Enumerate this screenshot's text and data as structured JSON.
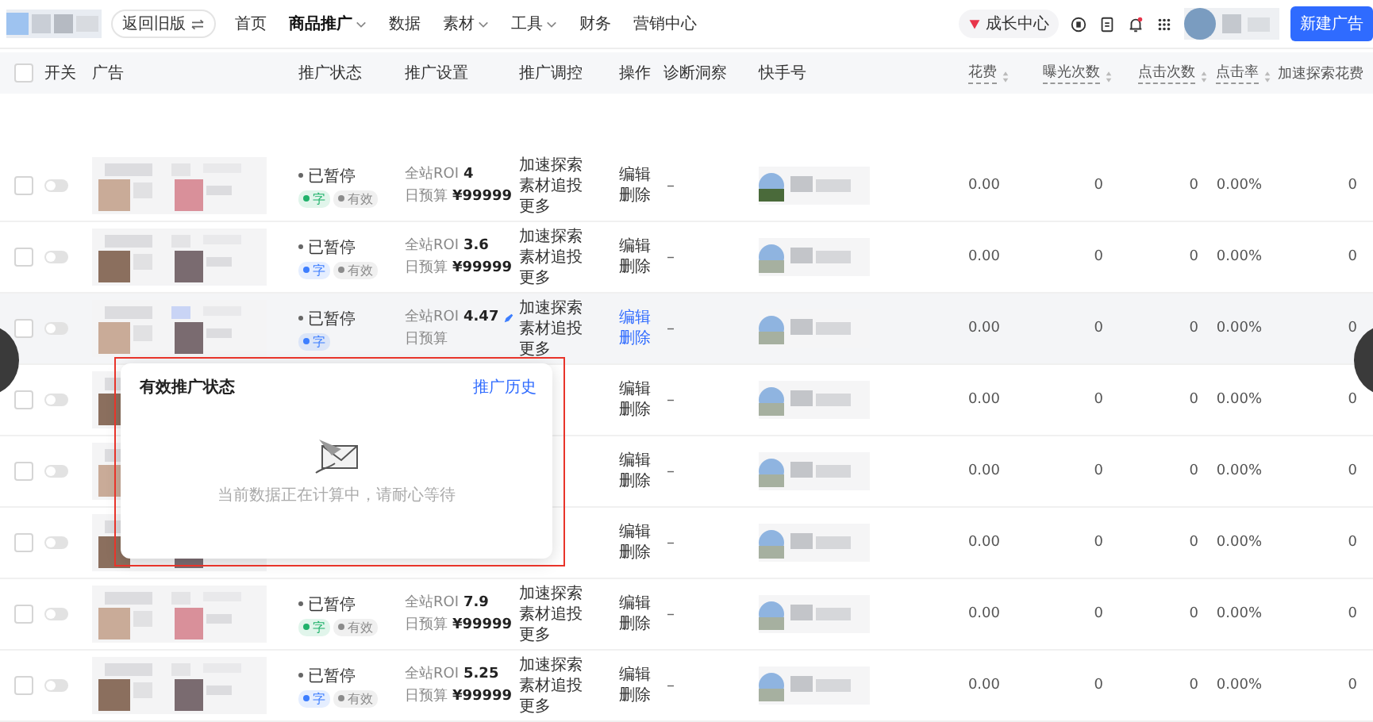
{
  "nav": {
    "back_label": "返回旧版",
    "menu": [
      {
        "label": "首页",
        "selected": false,
        "dropdown": false
      },
      {
        "label": "商品推广",
        "selected": true,
        "dropdown": true
      },
      {
        "label": "数据",
        "selected": false,
        "dropdown": false
      },
      {
        "label": "素材",
        "selected": false,
        "dropdown": true
      },
      {
        "label": "工具",
        "selected": false,
        "dropdown": true
      },
      {
        "label": "财务",
        "selected": false,
        "dropdown": false
      },
      {
        "label": "营销中心",
        "selected": false,
        "dropdown": false
      }
    ],
    "growth_label": "成长中心",
    "create_button": "新建广告"
  },
  "table": {
    "select_all_checked": false,
    "columns": [
      {
        "label": "开关",
        "sortable": false
      },
      {
        "label": "广告",
        "sortable": false
      },
      {
        "label": "推广状态",
        "sortable": false
      },
      {
        "label": "推广设置",
        "sortable": false
      },
      {
        "label": "推广调控",
        "sortable": false
      },
      {
        "label": "操作",
        "sortable": false
      },
      {
        "label": "诊断洞察",
        "sortable": false
      },
      {
        "label": "快手号",
        "sortable": false
      },
      {
        "label": "花费",
        "sortable": true
      },
      {
        "label": "曝光次数",
        "sortable": true
      },
      {
        "label": "点击次数",
        "sortable": true
      },
      {
        "label": "点击率",
        "sortable": true
      },
      {
        "label": "加速探索花费",
        "sortable": false
      }
    ],
    "rows": [
      {
        "hovered": false,
        "checked": false,
        "switch_on": false,
        "status": "已暂停",
        "tags": [
          {
            "label": "字",
            "color": "#21b26b"
          },
          {
            "label": "有效",
            "color": "#8c8c8c"
          }
        ],
        "roi_label": "全站ROI",
        "roi": "4",
        "budget_label": "日预算",
        "budget": "¥99999",
        "tuning": [
          "加速探索",
          "素材追投",
          "更多"
        ],
        "ops": [
          "编辑",
          "删除"
        ],
        "diagnosis": "–",
        "spend": "0.00",
        "impressions": "0",
        "clicks": "0",
        "ctr": "0.00%",
        "boost_spend": "0"
      },
      {
        "hovered": false,
        "checked": false,
        "switch_on": false,
        "status": "已暂停",
        "tags": [
          {
            "label": "字",
            "color": "#3d7eff"
          },
          {
            "label": "有效",
            "color": "#8c8c8c"
          }
        ],
        "roi_label": "全站ROI",
        "roi": "3.6",
        "budget_label": "日预算",
        "budget": "¥99999",
        "tuning": [
          "加速探索",
          "素材追投",
          "更多"
        ],
        "ops": [
          "编辑",
          "删除"
        ],
        "diagnosis": "–",
        "spend": "0.00",
        "impressions": "0",
        "clicks": "0",
        "ctr": "0.00%",
        "boost_spend": "0"
      },
      {
        "hovered": true,
        "checked": false,
        "switch_on": false,
        "status": "已暂停",
        "tags": [
          {
            "label": "字",
            "color": "#3d7eff"
          }
        ],
        "roi_label": "全站ROI",
        "roi": "4.47",
        "budget_label": "日预算",
        "tuning": [
          "加速探索",
          "素材追投",
          "更多"
        ],
        "ops": [
          "编辑",
          "删除"
        ],
        "diagnosis": "–",
        "spend": "0.00",
        "impressions": "0",
        "clicks": "0",
        "ctr": "0.00%",
        "boost_spend": "0"
      },
      {
        "hovered": false,
        "checked": false,
        "switch_on": false,
        "ops": [
          "编辑",
          "删除"
        ],
        "diagnosis": "–",
        "spend": "0.00",
        "impressions": "0",
        "clicks": "0",
        "ctr": "0.00%",
        "boost_spend": "0"
      },
      {
        "hovered": false,
        "checked": false,
        "switch_on": false,
        "ops": [
          "编辑",
          "删除"
        ],
        "diagnosis": "–",
        "spend": "0.00",
        "impressions": "0",
        "clicks": "0",
        "ctr": "0.00%",
        "boost_spend": "0"
      },
      {
        "hovered": false,
        "checked": false,
        "switch_on": false,
        "ops": [
          "编辑",
          "删除"
        ],
        "diagnosis": "–",
        "spend": "0.00",
        "impressions": "0",
        "clicks": "0",
        "ctr": "0.00%",
        "boost_spend": "0"
      },
      {
        "hovered": false,
        "checked": false,
        "switch_on": false,
        "status": "已暂停",
        "tags": [
          {
            "label": "字",
            "color": "#21b26b"
          },
          {
            "label": "有效",
            "color": "#8c8c8c"
          }
        ],
        "roi_label": "全站ROI",
        "roi": "7.9",
        "budget_label": "日预算",
        "budget": "¥99999",
        "tuning": [
          "加速探索",
          "素材追投",
          "更多"
        ],
        "ops": [
          "编辑",
          "删除"
        ],
        "diagnosis": "–",
        "spend": "0.00",
        "impressions": "0",
        "clicks": "0",
        "ctr": "0.00%",
        "boost_spend": "0"
      },
      {
        "hovered": false,
        "checked": false,
        "switch_on": false,
        "status": "已暂停",
        "tags": [
          {
            "label": "字",
            "color": "#3d7eff"
          },
          {
            "label": "有效",
            "color": "#8c8c8c"
          }
        ],
        "roi_label": "全站ROI",
        "roi": "5.25",
        "budget_label": "日预算",
        "budget": "¥99999",
        "tuning": [
          "加速探索",
          "素材追投",
          "更多"
        ],
        "ops": [
          "编辑",
          "删除"
        ],
        "diagnosis": "–",
        "spend": "0.00",
        "impressions": "0",
        "clicks": "0",
        "ctr": "0.00%",
        "boost_spend": "0"
      }
    ]
  },
  "popover": {
    "title": "有效推广状态",
    "link": "推广历史",
    "message": "当前数据正在计算中，请耐心等待"
  }
}
